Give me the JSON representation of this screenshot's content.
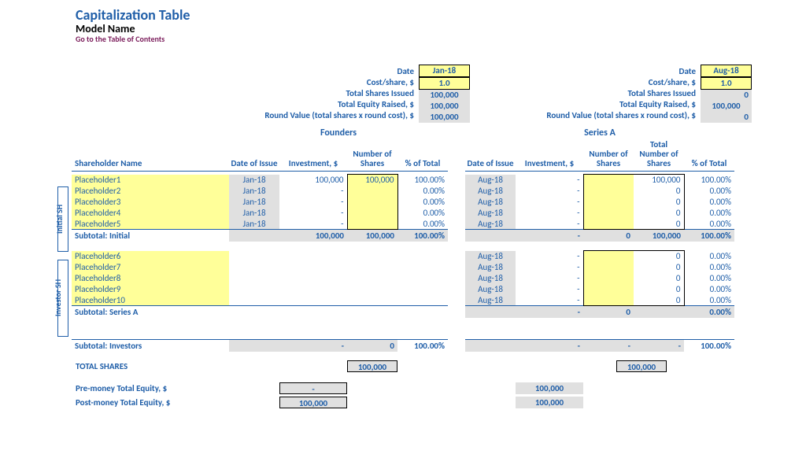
{
  "header": {
    "title": "Capitalization Table",
    "model_name": "Model Name",
    "toc_link": "Go to the Table of Contents"
  },
  "summary_labels": {
    "date": "Date",
    "cost_share": "Cost/share, $",
    "total_shares_issued": "Total Shares Issued",
    "total_equity_raised": "Total Equity Raised, $",
    "round_value": "Round Value (total shares x round cost), $"
  },
  "rounds": {
    "founders": {
      "name": "Founders",
      "date": "Jan-18",
      "cost_share": "1.0",
      "total_shares_issued": "100,000",
      "total_equity_raised": "100,000",
      "round_value": "100,000"
    },
    "series_a": {
      "name": "Series A",
      "date": "Aug-18",
      "cost_share": "1.0",
      "total_shares_issued": "0",
      "total_equity_raised": "100,000",
      "round_value": "0"
    }
  },
  "columns": {
    "shareholder": "Shareholder Name",
    "date_issue": "Date of Issue",
    "investment": "Investment, $",
    "num_shares": "Number of Shares",
    "pct_total": "% of Total",
    "total_num_shares": "Total Number of Shares"
  },
  "side": {
    "initial": "Initial SH",
    "investor": "Investor SH"
  },
  "initial_rows": [
    {
      "name": "Placeholder1",
      "f_date": "Jan-18",
      "f_inv": "100,000",
      "f_sh": "100,000",
      "f_pct": "100.00%",
      "a_date": "Aug-18",
      "a_inv": "-",
      "a_sh": "",
      "a_tot": "100,000",
      "a_pct": "100.00%"
    },
    {
      "name": "Placeholder2",
      "f_date": "Jan-18",
      "f_inv": "-",
      "f_sh": "",
      "f_pct": "0.00%",
      "a_date": "Aug-18",
      "a_inv": "-",
      "a_sh": "",
      "a_tot": "0",
      "a_pct": "0.00%"
    },
    {
      "name": "Placeholder3",
      "f_date": "Jan-18",
      "f_inv": "-",
      "f_sh": "",
      "f_pct": "0.00%",
      "a_date": "Aug-18",
      "a_inv": "-",
      "a_sh": "",
      "a_tot": "0",
      "a_pct": "0.00%"
    },
    {
      "name": "Placeholder4",
      "f_date": "Jan-18",
      "f_inv": "-",
      "f_sh": "",
      "f_pct": "0.00%",
      "a_date": "Aug-18",
      "a_inv": "-",
      "a_sh": "",
      "a_tot": "0",
      "a_pct": "0.00%"
    },
    {
      "name": "Placeholder5",
      "f_date": "Jan-18",
      "f_inv": "-",
      "f_sh": "",
      "f_pct": "0.00%",
      "a_date": "Aug-18",
      "a_inv": "-",
      "a_sh": "",
      "a_tot": "0",
      "a_pct": "0.00%"
    }
  ],
  "initial_subtotal": {
    "label": "Subtotal: Initial",
    "f_inv": "100,000",
    "f_sh": "100,000",
    "f_pct": "100.00%",
    "a_inv": "-",
    "a_sh": "0",
    "a_tot": "100,000",
    "a_pct": "100.00%"
  },
  "investor_rows": [
    {
      "name": "Placeholder6",
      "a_date": "Aug-18",
      "a_inv": "-",
      "a_sh": "",
      "a_tot": "0",
      "a_pct": "0.00%"
    },
    {
      "name": "Placeholder7",
      "a_date": "Aug-18",
      "a_inv": "-",
      "a_sh": "",
      "a_tot": "0",
      "a_pct": "0.00%"
    },
    {
      "name": "Placeholder8",
      "a_date": "Aug-18",
      "a_inv": "-",
      "a_sh": "",
      "a_tot": "0",
      "a_pct": "0.00%"
    },
    {
      "name": "Placeholder9",
      "a_date": "Aug-18",
      "a_inv": "-",
      "a_sh": "",
      "a_tot": "0",
      "a_pct": "0.00%"
    },
    {
      "name": "Placeholder10",
      "a_date": "Aug-18",
      "a_inv": "-",
      "a_sh": "",
      "a_tot": "0",
      "a_pct": "0.00%"
    }
  ],
  "series_a_subtotal": {
    "label": "Subtotal: Series A",
    "a_inv": "-",
    "a_sh": "0",
    "a_tot": "",
    "a_pct": "0.00%"
  },
  "investors_subtotal": {
    "label": "Subtotal: Investors",
    "f_inv": "-",
    "f_sh": "0",
    "f_pct": "100.00%",
    "a_inv": "-",
    "a_sh": "-",
    "a_tot": "-",
    "a_pct": "100.00%"
  },
  "totals": {
    "total_shares_label": "TOTAL SHARES",
    "total_shares_f": "100,000",
    "total_shares_a": "100,000",
    "pre_money_label": "Pre-money Total Equity, $",
    "pre_money_f": "-",
    "pre_money_a": "100,000",
    "post_money_label": "Post-money Total Equity, $",
    "post_money_f": "100,000",
    "post_money_a": "100,000"
  }
}
